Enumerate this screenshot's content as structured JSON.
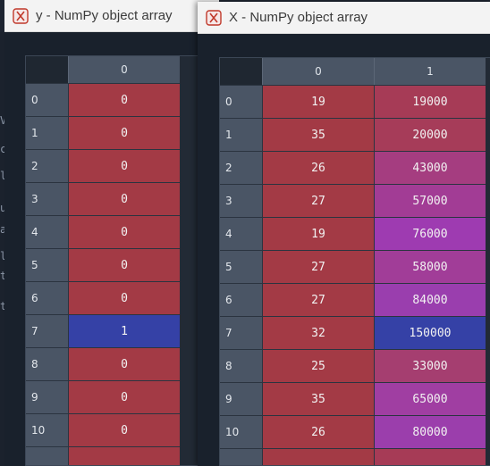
{
  "windows": [
    {
      "id": "y",
      "title": "y - NumPy object array",
      "columns": [
        "0"
      ],
      "rows": [
        {
          "index": "0",
          "values": [
            "0"
          ]
        },
        {
          "index": "1",
          "values": [
            "0"
          ]
        },
        {
          "index": "2",
          "values": [
            "0"
          ]
        },
        {
          "index": "3",
          "values": [
            "0"
          ]
        },
        {
          "index": "4",
          "values": [
            "0"
          ]
        },
        {
          "index": "5",
          "values": [
            "0"
          ]
        },
        {
          "index": "6",
          "values": [
            "0"
          ]
        },
        {
          "index": "7",
          "values": [
            "1"
          ]
        },
        {
          "index": "8",
          "values": [
            "0"
          ]
        },
        {
          "index": "9",
          "values": [
            "0"
          ]
        },
        {
          "index": "10",
          "values": [
            "0"
          ]
        }
      ],
      "colors": [
        [
          "#a33a45"
        ],
        [
          "#a33a45"
        ],
        [
          "#a33a45"
        ],
        [
          "#a33a45"
        ],
        [
          "#a33a45"
        ],
        [
          "#a33a45"
        ],
        [
          "#a33a45"
        ],
        [
          "#3541a6"
        ],
        [
          "#a33a45"
        ],
        [
          "#a33a45"
        ],
        [
          "#a33a45"
        ]
      ]
    },
    {
      "id": "x",
      "title": "X - NumPy object array",
      "columns": [
        "0",
        "1"
      ],
      "rows": [
        {
          "index": "0",
          "values": [
            "19",
            "19000"
          ]
        },
        {
          "index": "1",
          "values": [
            "35",
            "20000"
          ]
        },
        {
          "index": "2",
          "values": [
            "26",
            "43000"
          ]
        },
        {
          "index": "3",
          "values": [
            "27",
            "57000"
          ]
        },
        {
          "index": "4",
          "values": [
            "19",
            "76000"
          ]
        },
        {
          "index": "5",
          "values": [
            "27",
            "58000"
          ]
        },
        {
          "index": "6",
          "values": [
            "27",
            "84000"
          ]
        },
        {
          "index": "7",
          "values": [
            "32",
            "150000"
          ]
        },
        {
          "index": "8",
          "values": [
            "25",
            "33000"
          ]
        },
        {
          "index": "9",
          "values": [
            "35",
            "65000"
          ]
        },
        {
          "index": "10",
          "values": [
            "26",
            "80000"
          ]
        }
      ],
      "colors": [
        [
          "#a33a45",
          "#a63b56"
        ],
        [
          "#a33a45",
          "#a63c59"
        ],
        [
          "#a33a45",
          "#a53d80"
        ],
        [
          "#a33a45",
          "#a23c95"
        ],
        [
          "#a33a45",
          "#9e3bb1"
        ],
        [
          "#a33a45",
          "#a13d98"
        ],
        [
          "#a33a45",
          "#9a3eae"
        ],
        [
          "#a33a45",
          "#3541a6"
        ],
        [
          "#a33a45",
          "#a53e70"
        ],
        [
          "#a33a45",
          "#a03ea2"
        ],
        [
          "#a33a45",
          "#9b3eac"
        ]
      ]
    }
  ],
  "background_glyphs": [
    "V",
    "c",
    "l",
    "u",
    "a",
    "l",
    "t",
    "t"
  ]
}
